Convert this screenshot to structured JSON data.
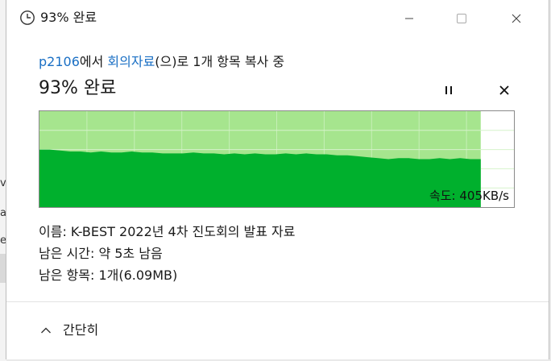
{
  "window": {
    "title": "93% 완료",
    "icon": "clock-icon"
  },
  "header": {
    "source_link": "p2106",
    "text_1": "에서 ",
    "dest_link": "회의자료",
    "text_2": "(으)로 1개 항목 복사 중"
  },
  "progress": {
    "title": "93% 완료",
    "percent": 93
  },
  "graph": {
    "speed_label": "속도: 405KB/s",
    "speed_history": [
      60,
      60,
      59,
      58,
      58,
      57,
      58,
      57,
      57,
      58,
      57,
      57,
      56,
      56,
      56,
      57,
      56,
      56,
      55,
      56,
      55,
      56,
      55,
      55,
      56,
      55,
      56,
      55,
      55,
      54,
      54,
      53,
      52,
      51,
      50,
      51,
      51,
      50,
      50,
      51,
      50,
      51,
      50,
      50
    ]
  },
  "details": {
    "name": "이름: K-BEST 2022년 4차 진도회의 발표 자료",
    "time_left": "남은 시간: 약 5초 남음",
    "items_left": "남은 항목: 1개(6.09MB)"
  },
  "footer": {
    "collapse_label": "간단히"
  },
  "background_fragments": [
    "v",
    "a",
    "e"
  ],
  "colors": {
    "graph_fill": "#00b02d",
    "graph_done": "#a6e58e",
    "link": "#1a6fc4"
  }
}
